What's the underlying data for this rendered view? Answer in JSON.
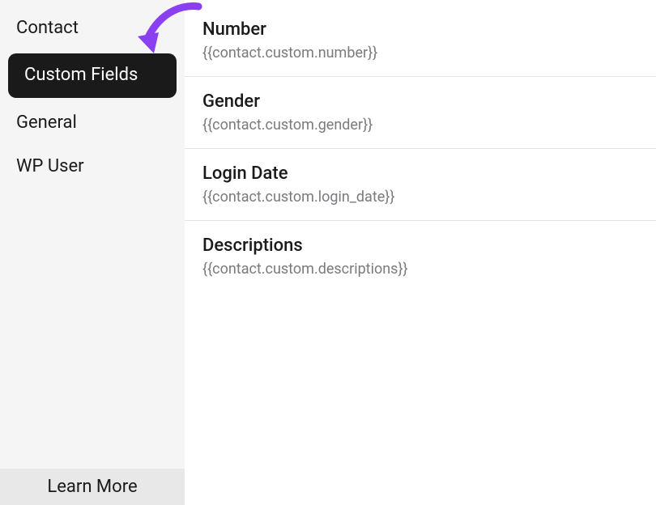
{
  "sidebar": {
    "items": [
      {
        "label": "Contact",
        "active": false
      },
      {
        "label": "Custom Fields",
        "active": true
      },
      {
        "label": "General",
        "active": false
      },
      {
        "label": "WP User",
        "active": false
      }
    ],
    "footer_label": "Learn More"
  },
  "main": {
    "fields": [
      {
        "title": "Number",
        "token": "{{contact.custom.number}}"
      },
      {
        "title": "Gender",
        "token": "{{contact.custom.gender}}"
      },
      {
        "title": "Login Date",
        "token": "{{contact.custom.login_date}}"
      },
      {
        "title": "Descriptions",
        "token": "{{contact.custom.descriptions}}"
      }
    ]
  },
  "annotation": {
    "arrow_color": "#8a3ff1"
  }
}
